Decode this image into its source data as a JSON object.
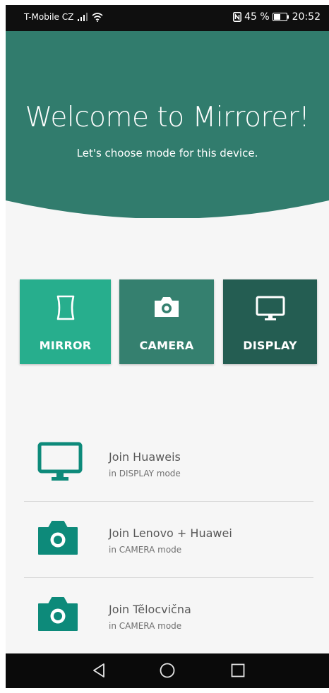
{
  "status_bar": {
    "carrier": "T-Mobile CZ",
    "battery_percent": "45 %",
    "time": "20:52",
    "icons": [
      "signal-icon",
      "wifi-icon",
      "nfc-icon",
      "battery-icon"
    ]
  },
  "header": {
    "title": "Welcome to Mirrorer!",
    "subtitle": "Let's choose mode for this device."
  },
  "modes": [
    {
      "label": "MIRROR",
      "icon": "mirror-icon",
      "color": "#27ae8d"
    },
    {
      "label": "CAMERA",
      "icon": "camera-icon",
      "color": "#35806f"
    },
    {
      "label": "DISPLAY",
      "icon": "monitor-icon",
      "color": "#245d52"
    }
  ],
  "devices": [
    {
      "name": "Join Huaweis",
      "mode": "in DISPLAY mode",
      "icon": "monitor-icon"
    },
    {
      "name": "Join Lenovo + Huawei",
      "mode": "in CAMERA mode",
      "icon": "camera-icon"
    },
    {
      "name": "Join Tělocvična",
      "mode": "in CAMERA mode",
      "icon": "camera-icon"
    }
  ],
  "nav_bar": {
    "icons": [
      "back-icon",
      "home-icon",
      "recents-icon"
    ]
  },
  "colors": {
    "header": "#317c6d",
    "accent_icon": "#0d8a7a",
    "background": "#f6f6f6"
  }
}
